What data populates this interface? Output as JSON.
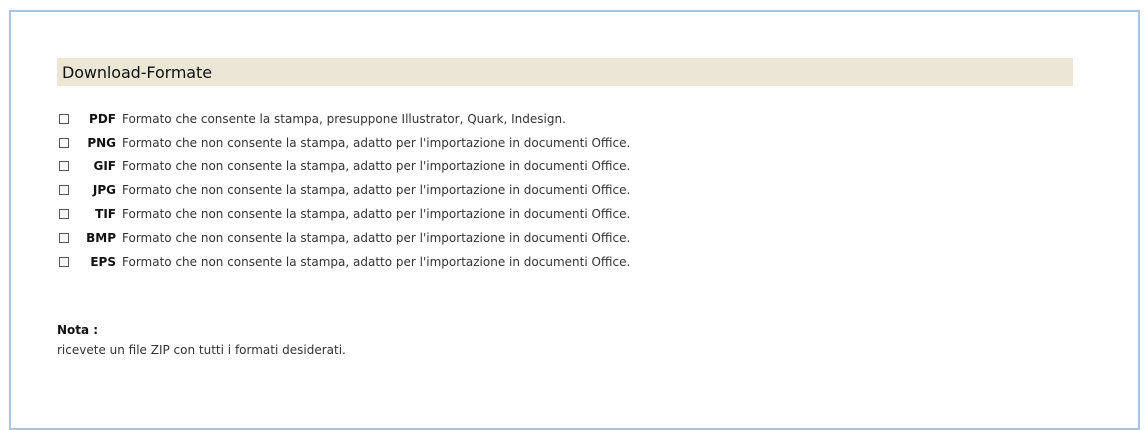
{
  "section": {
    "title": "Download-Formate"
  },
  "formats": [
    {
      "code": "PDF",
      "description": "Formato che consente la stampa, presuppone Illustrator, Quark, Indesign.",
      "checked": false
    },
    {
      "code": "PNG",
      "description": "Formato che non consente la stampa, adatto per l'importazione in documenti Office.",
      "checked": false
    },
    {
      "code": "GIF",
      "description": "Formato che non consente la stampa, adatto per l'importazione in documenti Office.",
      "checked": false
    },
    {
      "code": "JPG",
      "description": "Formato che non consente la stampa, adatto per l'importazione in documenti Office.",
      "checked": false
    },
    {
      "code": "TIF",
      "description": "Formato che non consente la stampa, adatto per l'importazione in documenti Office.",
      "checked": false
    },
    {
      "code": "BMP",
      "description": "Formato che non consente la stampa, adatto per l'importazione in documenti Office.",
      "checked": false
    },
    {
      "code": "EPS",
      "description": "Formato che non consente la stampa, adatto per l'importazione in documenti Office.",
      "checked": false
    }
  ],
  "note": {
    "title": "Nota :",
    "text": "ricevete un file ZIP con tutti i formati desiderati."
  },
  "colors": {
    "frame_border": "#a9c4e2",
    "header_background": "#ece6d6"
  }
}
